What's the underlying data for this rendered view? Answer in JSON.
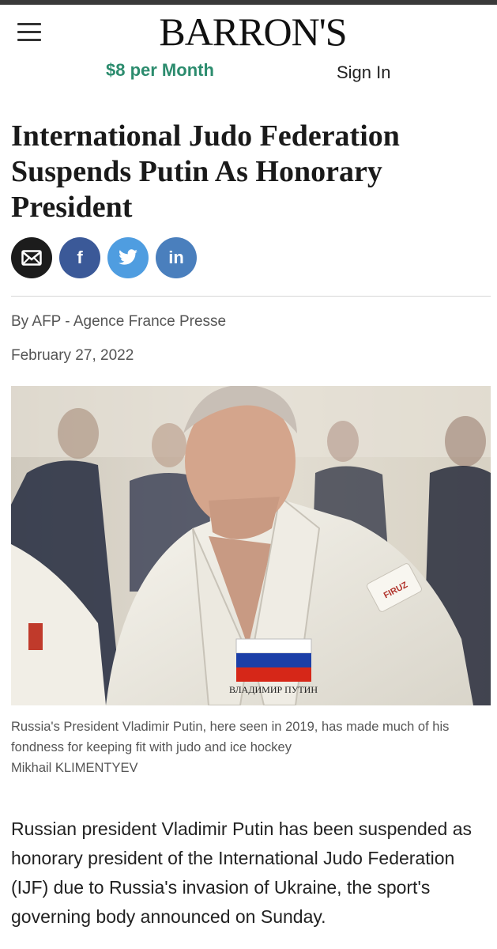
{
  "header": {
    "logo_text": "BARRON'S",
    "subscribe_label": "$8 per Month",
    "signin_label": "Sign In"
  },
  "article": {
    "headline": "International Judo Federation Suspends Putin As Honorary President",
    "byline": "By AFP - Agence France Presse",
    "date": "February 27, 2022",
    "image": {
      "caption": "Russia's President Vladimir Putin, here seen in 2019, has made much of his fondness for keeping fit with judo and ice hockey",
      "credit": "Mikhail KLIMENTYEV",
      "gi_patch_text": "ВЛАДИМИР ПУТИН",
      "sleeve_patch_text": "FIRUZ"
    },
    "body": "Russian president Vladimir Putin has been suspended as honorary president of the International Judo Federation (IJF) due to Russia's invasion of Ukraine, the sport's governing body announced on Sunday."
  },
  "share": {
    "email_icon": "envelope-icon",
    "facebook_glyph": "f",
    "twitter_icon": "twitter-bird-icon",
    "linkedin_glyph": "in"
  },
  "colors": {
    "brand_green": "#2c8c6e",
    "facebook": "#3b5998",
    "twitter": "#4f9de0",
    "linkedin": "#4a7fbd"
  }
}
